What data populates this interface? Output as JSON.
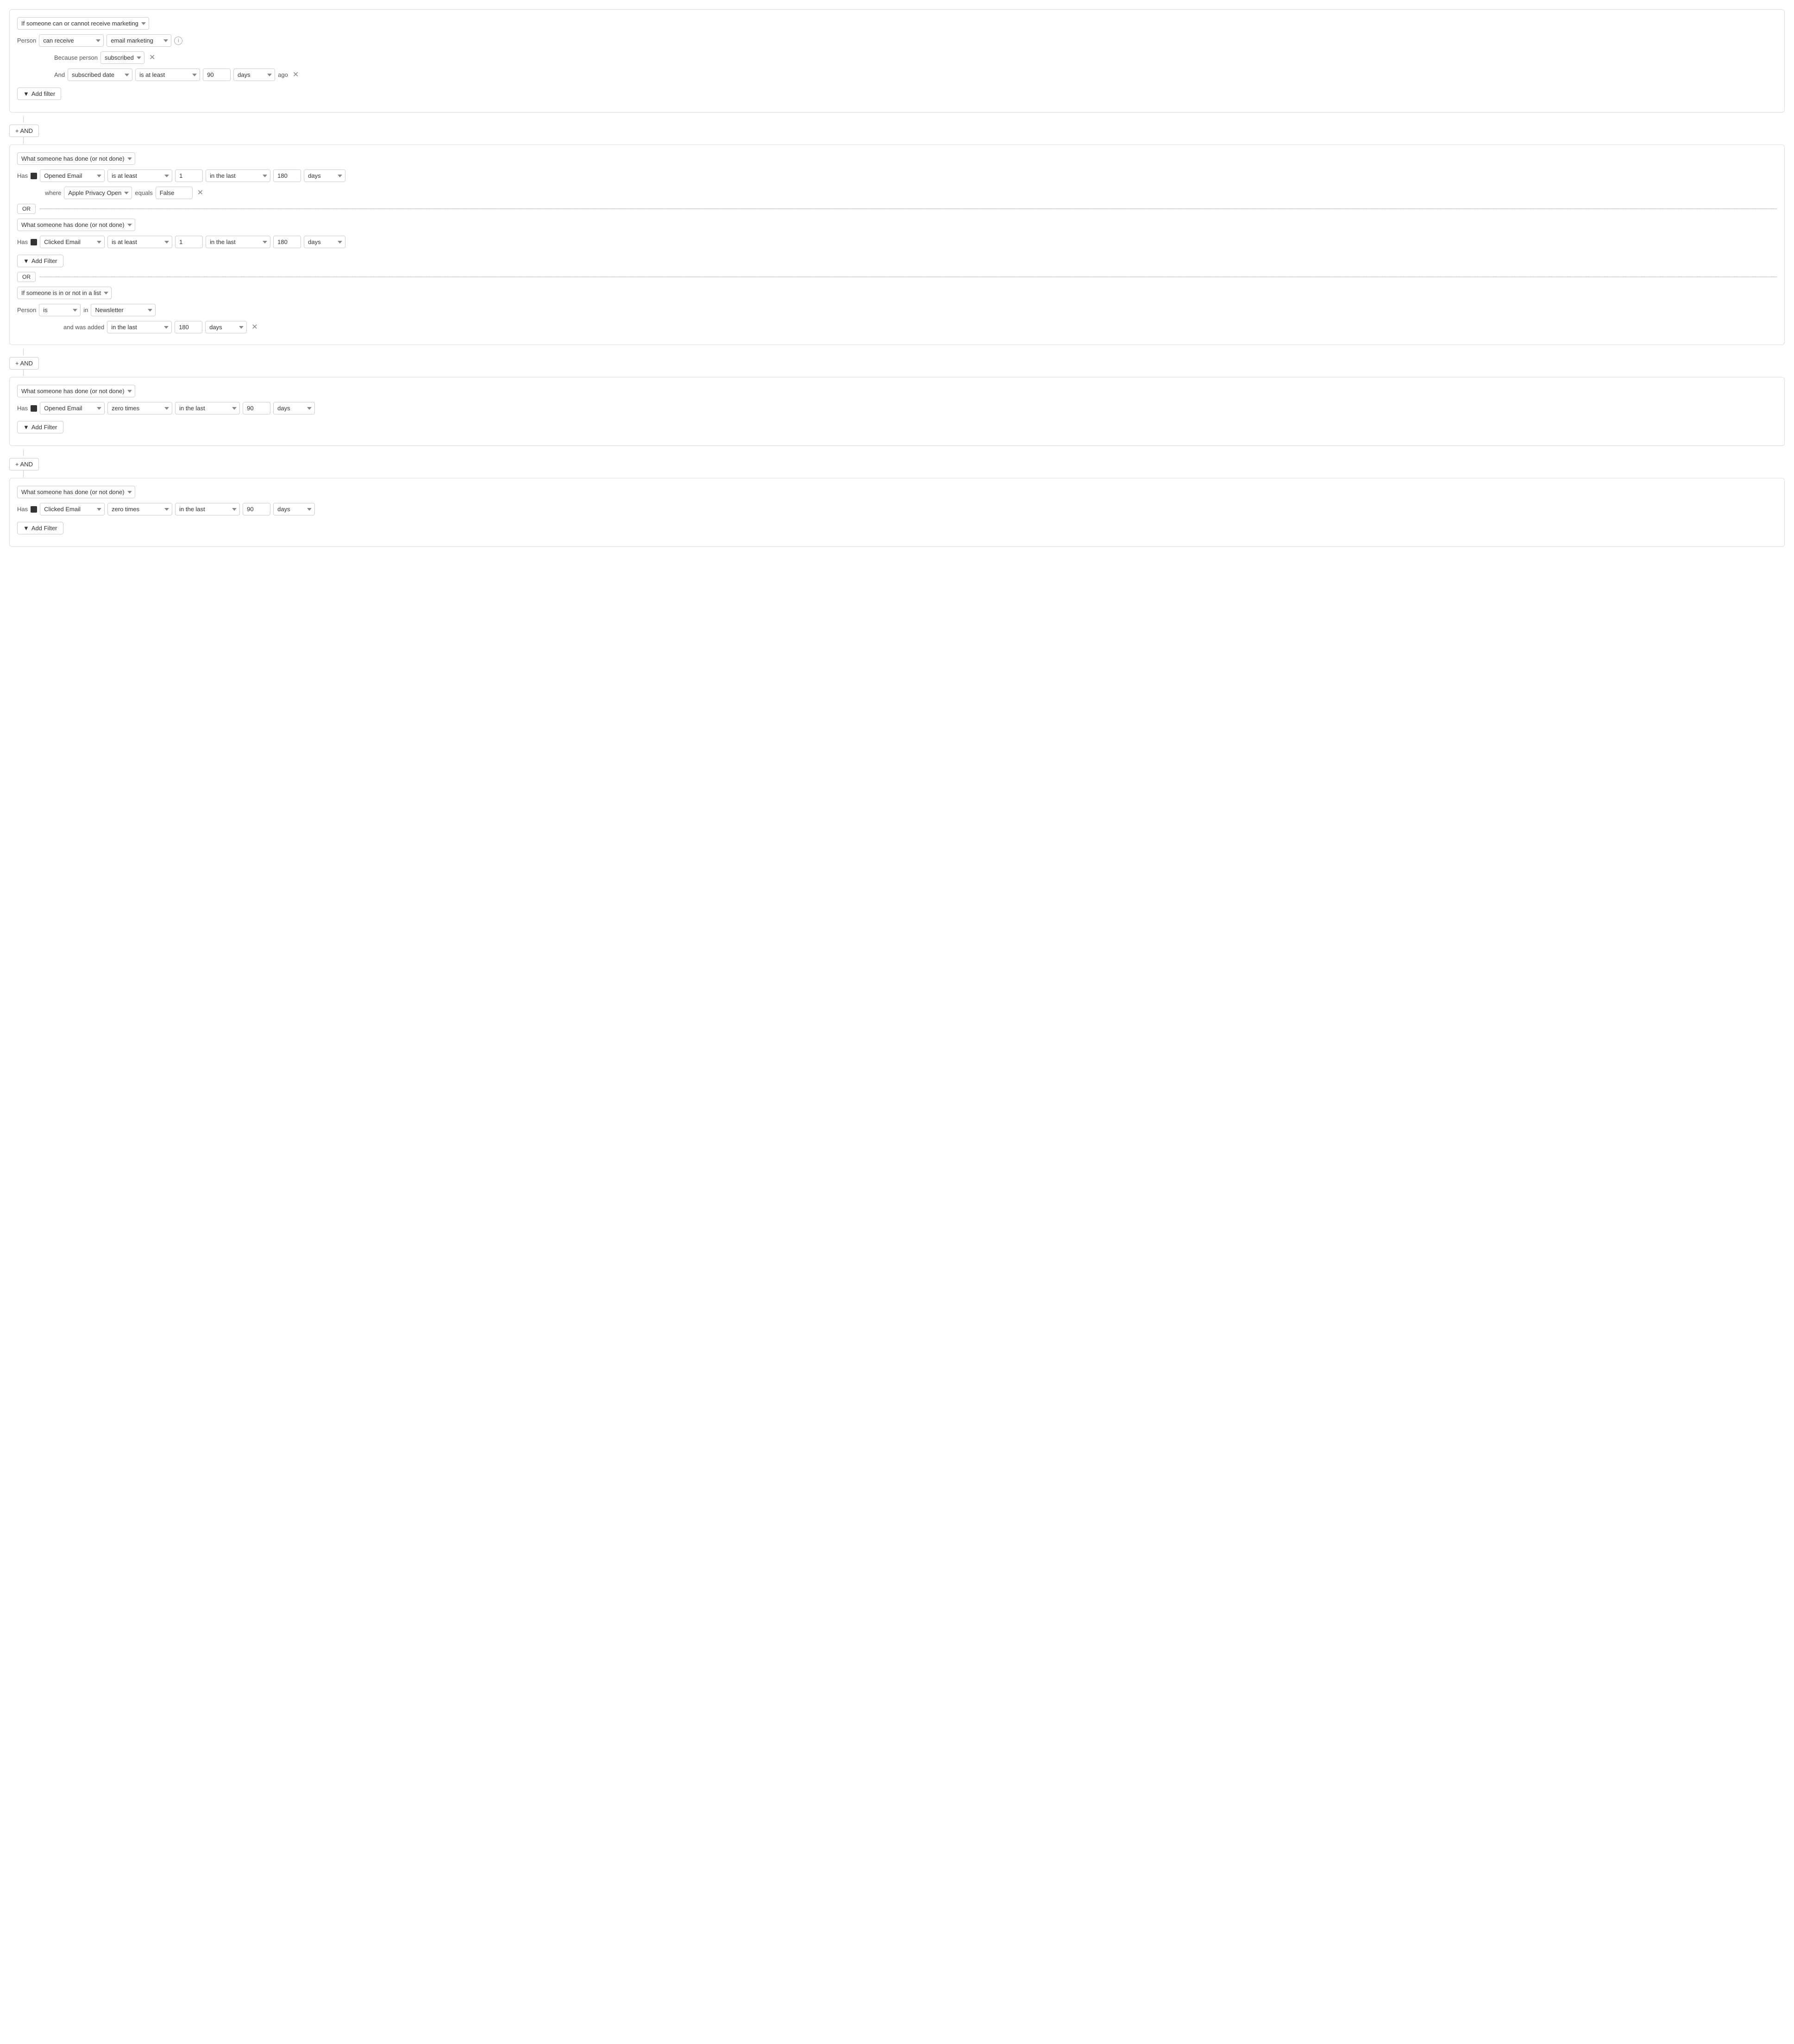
{
  "blocks": [
    {
      "id": "block1",
      "type": "marketing",
      "conditionLabel": "If someone can or cannot receive marketing",
      "personLabel": "Person",
      "personCondition": "can receive",
      "channel": "email marketing",
      "becauseLabel": "Because person",
      "becauseValue": "subscribed",
      "andLabel": "And",
      "dateField": "subscribed date",
      "dateCondition": "is at least",
      "dateValue": "90",
      "datePeriod": "days",
      "agoLabel": "ago",
      "addFilterLabel": "Add filter"
    },
    {
      "id": "block2",
      "type": "activity_group",
      "subBlocks": [
        {
          "id": "sub1",
          "conditionLabel": "What someone has done (or not done)",
          "hasLabel": "Has",
          "event": "Opened Email",
          "eventCondition": "is at least",
          "eventValue": "1",
          "timePeriodCondition": "in the last",
          "timePeriodValue": "180",
          "timePeriodUnit": "days",
          "hasWhere": true,
          "whereField": "Apple Privacy Open",
          "whereCondition": "equals",
          "whereValue": "False"
        },
        {
          "id": "sub2",
          "conditionLabel": "What someone has done (or not done)",
          "hasLabel": "Has",
          "event": "Clicked Email",
          "eventCondition": "is at least",
          "eventValue": "1",
          "timePeriodCondition": "in the last",
          "timePeriodValue": "180",
          "timePeriodUnit": "days",
          "hasWhere": false,
          "addFilterLabel": "Add Filter"
        },
        {
          "id": "sub3",
          "conditionLabel": "If someone is in or not in a list",
          "personLabel": "Person",
          "personCondition": "is",
          "listPrep": "in",
          "listName": "Newsletter",
          "wasAddedLabel": "and was added",
          "wasAddedCondition": "in the last",
          "wasAddedValue": "180",
          "wasAddedUnit": "days"
        }
      ]
    },
    {
      "id": "block3",
      "type": "activity",
      "conditionLabel": "What someone has done (or not done)",
      "hasLabel": "Has",
      "event": "Opened Email",
      "eventCondition": "zero times",
      "timePeriodCondition": "in the last",
      "timePeriodValue": "90",
      "timePeriodUnit": "days",
      "addFilterLabel": "Add Filter"
    },
    {
      "id": "block4",
      "type": "activity",
      "conditionLabel": "What someone has done (or not done)",
      "hasLabel": "Has",
      "event": "Clicked Email",
      "eventCondition": "zero times",
      "timePeriodCondition": "in the last",
      "timePeriodValue": "90",
      "timePeriodUnit": "days",
      "addFilterLabel": "Add Filter"
    }
  ],
  "andButtonLabel": "+ AND",
  "orButtonLabel": "OR",
  "addFilterLabel": "Add filter",
  "addFilterIconLabel": "▼",
  "infoIconLabel": "i"
}
